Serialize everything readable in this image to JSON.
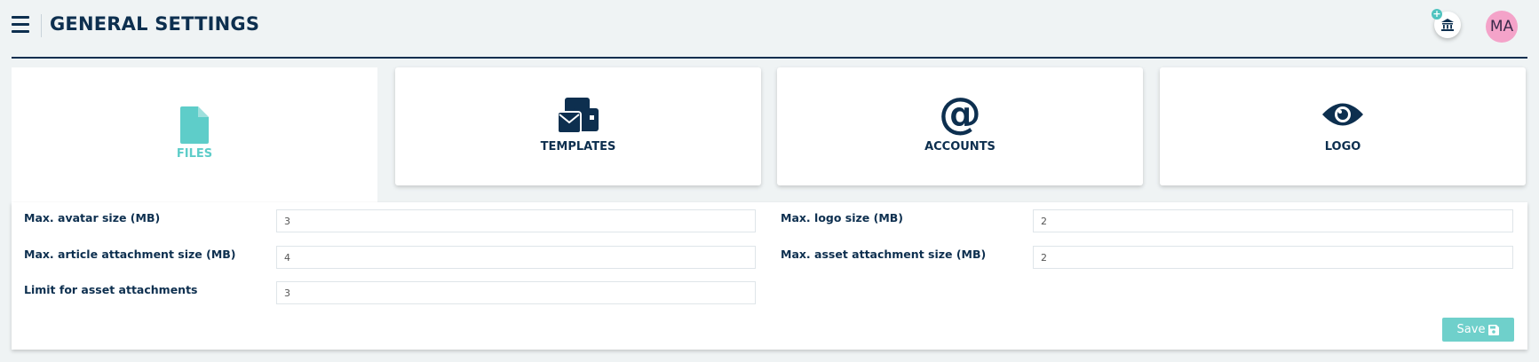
{
  "header": {
    "title": "GENERAL SETTINGS",
    "avatar_initials": "MA",
    "org_badge": "+"
  },
  "tabs": [
    {
      "label": "FILES",
      "icon": "file-icon",
      "active": true
    },
    {
      "label": "TEMPLATES",
      "icon": "envelopes-icon",
      "active": false
    },
    {
      "label": "ACCOUNTS",
      "icon": "at-icon",
      "active": false
    },
    {
      "label": "LOGO",
      "icon": "eye-icon",
      "active": false
    }
  ],
  "fields": {
    "avatar_size": {
      "label": "Max. avatar size (MB)",
      "value": "3"
    },
    "article_attachment_size": {
      "label": "Max. article attachment size (MB)",
      "value": "4"
    },
    "asset_attachment_limit": {
      "label": "Limit for asset attachments",
      "value": "3"
    },
    "logo_size": {
      "label": "Max. logo size (MB)",
      "value": "2"
    },
    "asset_attachment_size": {
      "label": "Max. asset attachment size (MB)",
      "value": "2"
    }
  },
  "actions": {
    "save_label": "Save"
  },
  "colors": {
    "primary": "#0d2f4f",
    "accent": "#5ecdc9",
    "avatar_bg": "#f4a3c9",
    "background": "#eff3f4"
  }
}
